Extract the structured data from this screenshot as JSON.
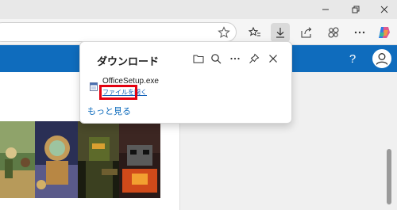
{
  "browser": {
    "window_buttons": [
      "minimize",
      "maximize",
      "close"
    ],
    "toolbar_icons": [
      "star-icon",
      "favorites-icon",
      "download-icon",
      "share-icon",
      "extensions-icon",
      "more-icon",
      "copilot-icon"
    ]
  },
  "site": {
    "help_label": "?",
    "accent": "#0f6cbd"
  },
  "downloads": {
    "title": "ダウンロード",
    "file_name": "OfficeSetup.exe",
    "open_file_label": "ファイルを開く",
    "see_more_label": "もっと見る"
  },
  "colors": {
    "highlight": "#e3000f",
    "link": "#0f5fb8"
  }
}
